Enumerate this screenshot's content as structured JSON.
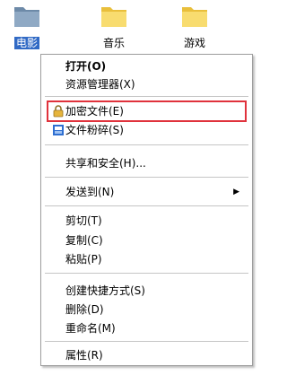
{
  "desktop": {
    "folders": [
      {
        "label": "电影",
        "selected": true
      },
      {
        "label": "音乐"
      },
      {
        "label": "游戏"
      }
    ]
  },
  "menu": {
    "items": [
      {
        "label": "打开(O)"
      },
      {
        "label": "资源管理器(X)"
      },
      {
        "label": "加密文件(E)",
        "icon": "lock-icon"
      },
      {
        "label": "文件粉碎(S)",
        "icon": "shredder-icon"
      },
      {
        "label": "共享和安全(H)..."
      },
      {
        "label": "发送到(N)"
      },
      {
        "label": "剪切(T)"
      },
      {
        "label": "复制(C)"
      },
      {
        "label": "粘贴(P)"
      },
      {
        "label": "创建快捷方式(S)"
      },
      {
        "label": "删除(D)"
      },
      {
        "label": "重命名(M)"
      },
      {
        "label": "属性(R)"
      }
    ]
  },
  "colors": {
    "selection": "#316ac5",
    "highlight_border": "#e0323c"
  }
}
